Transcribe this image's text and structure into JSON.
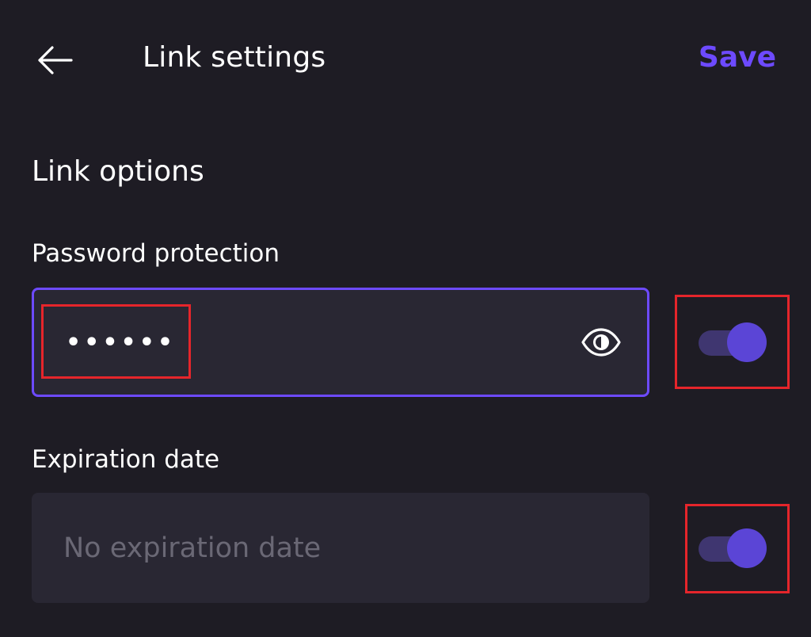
{
  "header": {
    "back_icon": "arrow-left-icon",
    "title": "Link settings",
    "save_label": "Save"
  },
  "section": {
    "heading": "Link options"
  },
  "password": {
    "label": "Password protection",
    "value": "••••••",
    "visibility_icon": "eye-icon",
    "toggle_on": true
  },
  "expiration": {
    "label": "Expiration date",
    "placeholder": "No expiration date",
    "toggle_on": true
  },
  "colors": {
    "background": "#1e1c24",
    "field_background": "#292733",
    "accent": "#6d4aff",
    "toggle_thumb": "#5b45d6",
    "toggle_track": "#3f3670",
    "placeholder_text": "#6a6875",
    "annotation": "#e5252b"
  }
}
